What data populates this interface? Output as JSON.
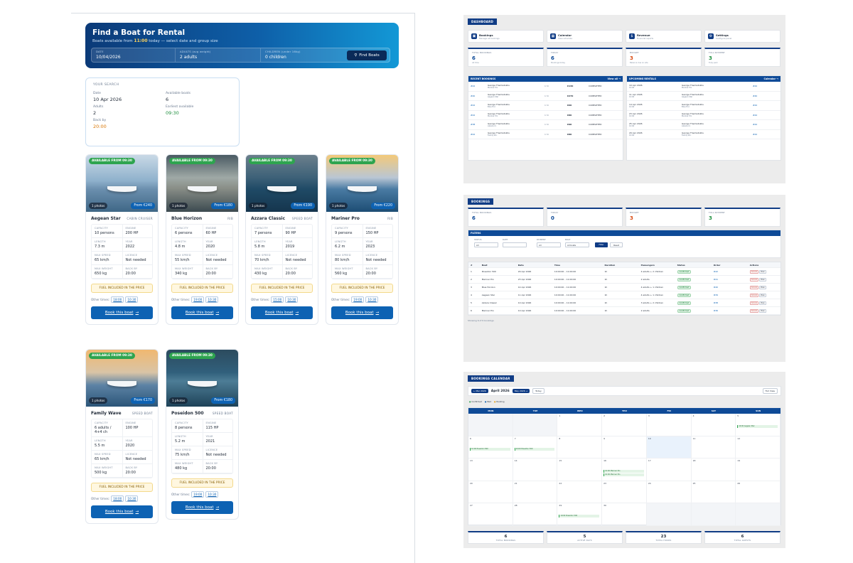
{
  "hero": {
    "title": "Find a Boat for Rental",
    "sub_pre": "Boats available from ",
    "sub_time": "11:00",
    "sub_post": " today — select date and group size",
    "fields": [
      {
        "label": "DATE",
        "value": "10/04/2026"
      },
      {
        "label": "ADULTS (avg weight)",
        "value": "2 adults"
      },
      {
        "label": "CHILDREN (under 16kg)",
        "value": "0 children"
      }
    ],
    "find_label": "Find Boats"
  },
  "search": {
    "title": "YOUR SEARCH",
    "items": [
      {
        "label": "Date",
        "value": "10 Apr 2026"
      },
      {
        "label": "Available boats",
        "value": "6"
      },
      {
        "label": "Adults",
        "value": "2"
      },
      {
        "label": "Earliest available",
        "value": "09:30"
      },
      {
        "label": "Back by",
        "value": "20:00"
      }
    ]
  },
  "spec_labels": [
    "CAPACITY",
    "ENGINE",
    "LENGTH",
    "YEAR",
    "MAX SPEED",
    "LICENCE",
    "MAX WEIGHT",
    "BACK BY"
  ],
  "fuel_label": "FUEL INCLUDED IN THE PRICE",
  "other_times_label": "Other times:",
  "book_label": "Book this boat",
  "boats": [
    {
      "badge": "AVAILABLE FROM 09:30",
      "photos": "1 photos",
      "price": "From €240",
      "name": "Aegean Star",
      "type": "CABIN CRUISER",
      "specs": [
        "10 persons",
        "200 HP",
        "7.3 m",
        "2022",
        "65 km/h",
        "Not needed",
        "650 kg",
        "20:00"
      ],
      "times": [
        "18:00",
        "10:30"
      ]
    },
    {
      "badge": "AVAILABLE FROM 09:30",
      "photos": "1 photos",
      "price": "From €180",
      "name": "Blue Horizon",
      "type": "RIB",
      "specs": [
        "6 persons",
        "60 HP",
        "4.8 m",
        "2020",
        "55 km/h",
        "Not needed",
        "340 kg",
        "20:00"
      ],
      "times": [
        "19:00",
        "10:30"
      ]
    },
    {
      "badge": "AVAILABLE FROM 09:30",
      "photos": "1 photos",
      "price": "From €190",
      "name": "Azzara Classic",
      "type": "SPEED BOAT",
      "specs": [
        "7 persons",
        "90 HP",
        "5.8 m",
        "2019",
        "70 km/h",
        "Not needed",
        "430 kg",
        "20:00"
      ],
      "times": [
        "15:00",
        "10:30"
      ]
    },
    {
      "badge": "AVAILABLE FROM 09:30",
      "photos": "1 photos",
      "price": "From €220",
      "name": "Mariner Pro",
      "type": "RIB",
      "specs": [
        "9 persons",
        "150 HP",
        "6.2 m",
        "2023",
        "80 km/h",
        "Not needed",
        "560 kg",
        "20:00"
      ],
      "times": [
        "19:00",
        "10:30"
      ]
    },
    {
      "badge": "AVAILABLE FROM 09:30",
      "photos": "1 photos",
      "price": "From €170",
      "name": "Family Wave",
      "type": "SPEED BOAT",
      "specs": [
        "6 adults / 4+4 ch",
        "100 HP",
        "5.5 m",
        "2020",
        "65 km/h",
        "Not needed",
        "500 kg",
        "20:00"
      ],
      "times": [
        "18:00",
        "10:30"
      ]
    },
    {
      "badge": "AVAILABLE FROM 09:30",
      "photos": "1 photos",
      "price": "From €180",
      "name": "Poseidon 500",
      "type": "SPEED BOAT",
      "specs": [
        "8 persons",
        "115 HP",
        "5.2 m",
        "2021",
        "75 km/h",
        "Not needed",
        "480 kg",
        "20:00"
      ],
      "times": [
        "19:00",
        "10:30"
      ]
    }
  ],
  "dashboard": {
    "title": "DASHBOARD",
    "nav": [
      {
        "title": "Bookings",
        "sub": "Manage all bookings"
      },
      {
        "title": "Calendar",
        "sub": "View schedule"
      },
      {
        "title": "Revenue",
        "sub": "Financial reports"
      },
      {
        "title": "Settings",
        "sub": "Configure panel"
      }
    ],
    "stats": [
      {
        "label": "TOTAL BOOKINGS",
        "value": "6",
        "sub": "All time"
      },
      {
        "label": "TODAY",
        "value": "6",
        "sub": "Bookings today"
      },
      {
        "label": "BUDGET",
        "value": "3",
        "sub": "Balance due on site"
      },
      {
        "label": "FULL PAYMENT",
        "value": "3",
        "sub": "Fully paid"
      }
    ],
    "recent_title": "RECENT BOOKINGS",
    "recent_link": "View all →",
    "recent_rows": [
      {
        "id": "#42",
        "name": "George Themistoklis",
        "boat": "Mariner Pro",
        "dur": "1 hr",
        "price": "€130",
        "status": "COMPLETED"
      },
      {
        "id": "#40",
        "name": "George Themistoklis",
        "boat": "Aegean Star",
        "dur": "1 hr",
        "price": "€270",
        "status": "COMPLETED"
      },
      {
        "id": "#42",
        "name": "George Themistoklis",
        "boat": "Blue Hor.",
        "dur": "1 hr",
        "price": "€60",
        "status": "COMPLETED"
      },
      {
        "id": "#42",
        "name": "George Themistoklis",
        "boat": "Mariner Pro",
        "dur": "1 hr",
        "price": "€80",
        "status": "COMPLETED"
      },
      {
        "id": "#38",
        "name": "George Themistoklis",
        "boat": "Azzara Cl.",
        "dur": "1 hr",
        "price": "€90",
        "status": "COMPLETED"
      },
      {
        "id": "#42",
        "name": "George Themistoklis",
        "boat": "Family Wv.",
        "dur": "1 hr",
        "price": "€80",
        "status": "COMPLETED"
      }
    ],
    "upcoming_title": "UPCOMING RENTALS",
    "upcoming_link": "Calendar →",
    "upcoming_rows": [
      {
        "date": "10 Apr 2026",
        "time": "10:00",
        "name": "George Themistoklis",
        "boat": "Mariner Pro",
        "id": "#42"
      },
      {
        "date": "11 Apr 2026",
        "time": "10:00",
        "name": "George Themistoklis",
        "boat": "Aegean Star",
        "id": "#40"
      },
      {
        "date": "14 Apr 2026",
        "time": "10:00",
        "name": "George Themistoklis",
        "boat": "Blue Hor.",
        "id": "#42"
      },
      {
        "date": "23 Apr 2026",
        "time": "10:00",
        "name": "George Themistoklis",
        "boat": "Mariner Pro",
        "id": "#42"
      },
      {
        "date": "25 Apr 2026",
        "time": "10:00",
        "name": "George Themistoklis",
        "boat": "Azzara Cl.",
        "id": "#42"
      },
      {
        "date": "29 Apr 2026",
        "time": "10:00",
        "name": "George Themistoklis",
        "boat": "Family Wv.",
        "id": "#42"
      }
    ]
  },
  "bookings": {
    "title": "BOOKINGS",
    "stats": [
      {
        "label": "TOTAL BOOKINGS",
        "value": "6"
      },
      {
        "label": "TODAY",
        "value": "0"
      },
      {
        "label": "BUDGET",
        "value": "3"
      },
      {
        "label": "FULL PAYMENT",
        "value": "3"
      }
    ],
    "filters_title": "FILTERS",
    "filters": [
      {
        "label": "STATUS",
        "value": "All"
      },
      {
        "label": "DATE",
        "value": ""
      },
      {
        "label": "PAYMENT",
        "value": "All"
      },
      {
        "label": "BOAT",
        "value": "All boats"
      }
    ],
    "filter_btn": "Filter",
    "reset_btn": "Reset",
    "columns": [
      "#",
      "Boat",
      "Date",
      "Time",
      "Duration",
      "Passengers",
      "Status",
      "Order",
      "Actions"
    ],
    "rows": [
      {
        "n": "1",
        "boat": "Poseidon 500",
        "date": "29 Apr 2026",
        "time": "10:00:00 – 11:00:00",
        "dur": "1h",
        "pax": "4 adults + 2 children",
        "status": "Confirmed",
        "order": "#42"
      },
      {
        "n": "2",
        "boat": "Mariner Pro",
        "date": "23 Apr 2026",
        "time": "10:00:00 – 11:00:00",
        "dur": "1h",
        "pax": "2 adults",
        "status": "Confirmed",
        "order": "#41"
      },
      {
        "n": "3",
        "boat": "Blue Horizon",
        "date": "14 Apr 2026",
        "time": "10:00:00 – 11:00:00",
        "dur": "1h",
        "pax": "4 adults + 1 children",
        "status": "Confirmed",
        "order": "#40"
      },
      {
        "n": "4",
        "boat": "Aegean Star",
        "date": "11 Apr 2026",
        "time": "10:00:00 – 11:00:00",
        "dur": "1h",
        "pax": "4 adults + 1 children",
        "status": "Confirmed",
        "order": "#39"
      },
      {
        "n": "5",
        "boat": "Azzara Classic",
        "date": "10 Apr 2026",
        "time": "10:00:00 – 11:00:00",
        "dur": "1h",
        "pax": "3 adults + 2 children",
        "status": "Confirmed",
        "order": "#38"
      },
      {
        "n": "6",
        "boat": "Mariner Pro",
        "date": "10 Apr 2026",
        "time": "10:00:00 – 11:00:00",
        "dur": "1h",
        "pax": "2 adults",
        "status": "Confirmed",
        "order": "#36"
      }
    ],
    "cancel_label": "Cancel",
    "view_label": "View",
    "footer": "Showing 6 of 6 bookings"
  },
  "calendar": {
    "title": "BOOKINGS CALENDAR",
    "prev": "← Mar 2026",
    "month": "April 2026",
    "next": "May 2026 →",
    "today": "Today",
    "full_view": "Full View",
    "legend": [
      "Confirmed",
      "Paid",
      "Pending"
    ],
    "days": [
      "MON",
      "TUE",
      "WED",
      "THU",
      "FRI",
      "SAT",
      "SUN"
    ],
    "cells": [
      "",
      "",
      "1",
      "2",
      "3",
      "4",
      "5",
      "6",
      "7",
      "8",
      "9",
      "10",
      "11",
      "12",
      "13",
      "14",
      "15",
      "16",
      "17",
      "18",
      "19",
      "20",
      "21",
      "22",
      "23",
      "24",
      "25",
      "26",
      "27",
      "28",
      "29",
      "30",
      "",
      "",
      ""
    ],
    "events": [
      {
        "cell": 6,
        "label": "10:00 Aegean Star"
      },
      {
        "cell": 7,
        "label": "10:00 Poseidon 500"
      },
      {
        "cell": 8,
        "label": "10:00 Poseidon 500"
      },
      {
        "cell": 17,
        "label": "10:00 Mariner Pro"
      },
      {
        "cell": 17,
        "label": "10:00 Mariner Pro"
      },
      {
        "cell": 30,
        "label": "10:00 Poseidon 500"
      }
    ],
    "stats": [
      {
        "value": "6",
        "label": "TOTAL BOOKINGS"
      },
      {
        "value": "5",
        "label": "ACTIVE DAYS"
      },
      {
        "value": "23",
        "label": "TOTAL HOURS"
      },
      {
        "value": "6",
        "label": "TOTAL GUESTS"
      }
    ]
  }
}
